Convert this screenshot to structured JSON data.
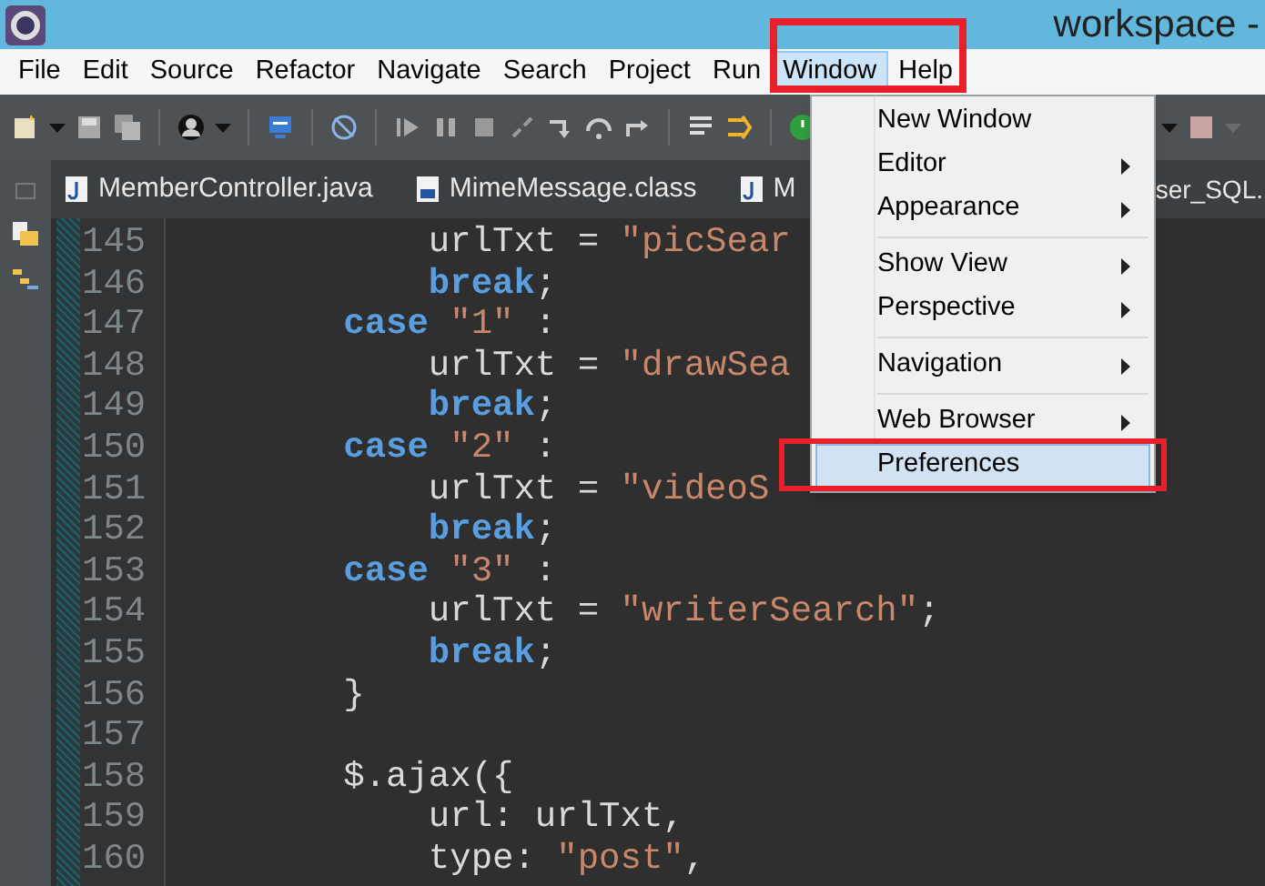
{
  "window": {
    "title": "workspace -"
  },
  "menubar": [
    {
      "label": "File",
      "selected": false
    },
    {
      "label": "Edit",
      "selected": false
    },
    {
      "label": "Source",
      "selected": false
    },
    {
      "label": "Refactor",
      "selected": false
    },
    {
      "label": "Navigate",
      "selected": false
    },
    {
      "label": "Search",
      "selected": false
    },
    {
      "label": "Project",
      "selected": false
    },
    {
      "label": "Run",
      "selected": false
    },
    {
      "label": "Window",
      "selected": true
    },
    {
      "label": "Help",
      "selected": false
    }
  ],
  "tabs": [
    {
      "label": "MemberController.java",
      "kind": "java"
    },
    {
      "label": "MimeMessage.class",
      "kind": "class"
    },
    {
      "label": "M",
      "kind": "java"
    },
    {
      "label": "ser_SQL.",
      "kind": "plain"
    }
  ],
  "editor": {
    "lines": [
      {
        "number": "145",
        "segments": [
          {
            "kind": "plain",
            "text": "            urlTxt = "
          },
          {
            "kind": "string",
            "text": "\"picSear"
          }
        ]
      },
      {
        "number": "146",
        "segments": [
          {
            "kind": "keyword",
            "text": "            break"
          },
          {
            "kind": "plain",
            "text": ";"
          }
        ]
      },
      {
        "number": "147",
        "segments": [
          {
            "kind": "keyword",
            "text": "        case "
          },
          {
            "kind": "string",
            "text": "\"1\""
          },
          {
            "kind": "plain",
            "text": " :"
          }
        ]
      },
      {
        "number": "148",
        "segments": [
          {
            "kind": "plain",
            "text": "            urlTxt = "
          },
          {
            "kind": "string",
            "text": "\"drawSea"
          }
        ]
      },
      {
        "number": "149",
        "segments": [
          {
            "kind": "keyword",
            "text": "            break"
          },
          {
            "kind": "plain",
            "text": ";"
          }
        ]
      },
      {
        "number": "150",
        "segments": [
          {
            "kind": "keyword",
            "text": "        case "
          },
          {
            "kind": "string",
            "text": "\"2\""
          },
          {
            "kind": "plain",
            "text": " :"
          }
        ]
      },
      {
        "number": "151",
        "segments": [
          {
            "kind": "plain",
            "text": "            urlTxt = "
          },
          {
            "kind": "string",
            "text": "\"videoS"
          }
        ]
      },
      {
        "number": "152",
        "segments": [
          {
            "kind": "keyword",
            "text": "            break"
          },
          {
            "kind": "plain",
            "text": ";"
          }
        ]
      },
      {
        "number": "153",
        "segments": [
          {
            "kind": "keyword",
            "text": "        case "
          },
          {
            "kind": "string",
            "text": "\"3\""
          },
          {
            "kind": "plain",
            "text": " :"
          }
        ]
      },
      {
        "number": "154",
        "segments": [
          {
            "kind": "plain",
            "text": "            urlTxt = "
          },
          {
            "kind": "string",
            "text": "\"writerSearch\""
          },
          {
            "kind": "plain",
            "text": ";"
          }
        ]
      },
      {
        "number": "155",
        "segments": [
          {
            "kind": "keyword",
            "text": "            break"
          },
          {
            "kind": "plain",
            "text": ";"
          }
        ]
      },
      {
        "number": "156",
        "segments": [
          {
            "kind": "plain",
            "text": "        }"
          }
        ]
      },
      {
        "number": "157"
      },
      {
        "number": "158",
        "segments": [
          {
            "kind": "plain",
            "text": "        $.ajax({"
          }
        ]
      },
      {
        "number": "159",
        "segments": [
          {
            "kind": "plain",
            "text": "            url: urlTxt,"
          }
        ]
      },
      {
        "number": "160",
        "segments": [
          {
            "kind": "plain",
            "text": "            type: "
          },
          {
            "kind": "string",
            "text": "\"post\""
          },
          {
            "kind": "plain",
            "text": ","
          }
        ]
      }
    ]
  },
  "window_menu": [
    {
      "kind": "item",
      "label": "New Window",
      "submenu": false,
      "selected": false
    },
    {
      "kind": "item",
      "label": "Editor",
      "submenu": true,
      "selected": false
    },
    {
      "kind": "item",
      "label": "Appearance",
      "submenu": true,
      "selected": false
    },
    {
      "kind": "separator"
    },
    {
      "kind": "item",
      "label": "Show View",
      "submenu": true,
      "selected": false
    },
    {
      "kind": "item",
      "label": "Perspective",
      "submenu": true,
      "selected": false
    },
    {
      "kind": "separator"
    },
    {
      "kind": "item",
      "label": "Navigation",
      "submenu": true,
      "selected": false
    },
    {
      "kind": "separator"
    },
    {
      "kind": "item",
      "label": "Web Browser",
      "submenu": true,
      "selected": false
    },
    {
      "kind": "item",
      "label": "Preferences",
      "submenu": false,
      "selected": true
    }
  ]
}
